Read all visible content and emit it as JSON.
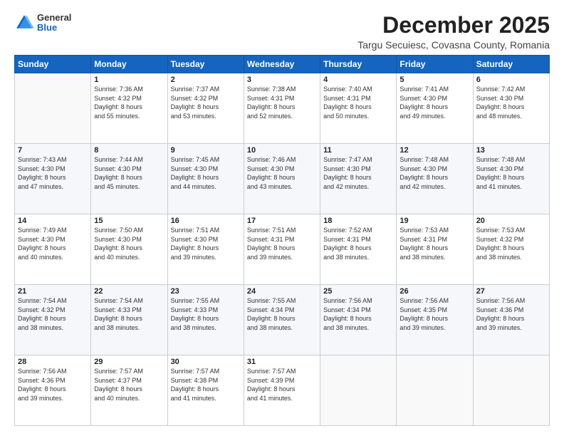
{
  "logo": {
    "general": "General",
    "blue": "Blue"
  },
  "title": "December 2025",
  "subtitle": "Targu Secuiesc, Covasna County, Romania",
  "header_days": [
    "Sunday",
    "Monday",
    "Tuesday",
    "Wednesday",
    "Thursday",
    "Friday",
    "Saturday"
  ],
  "weeks": [
    [
      {
        "day": "",
        "info": ""
      },
      {
        "day": "1",
        "info": "Sunrise: 7:36 AM\nSunset: 4:32 PM\nDaylight: 8 hours\nand 55 minutes."
      },
      {
        "day": "2",
        "info": "Sunrise: 7:37 AM\nSunset: 4:32 PM\nDaylight: 8 hours\nand 53 minutes."
      },
      {
        "day": "3",
        "info": "Sunrise: 7:38 AM\nSunset: 4:31 PM\nDaylight: 8 hours\nand 52 minutes."
      },
      {
        "day": "4",
        "info": "Sunrise: 7:40 AM\nSunset: 4:31 PM\nDaylight: 8 hours\nand 50 minutes."
      },
      {
        "day": "5",
        "info": "Sunrise: 7:41 AM\nSunset: 4:30 PM\nDaylight: 8 hours\nand 49 minutes."
      },
      {
        "day": "6",
        "info": "Sunrise: 7:42 AM\nSunset: 4:30 PM\nDaylight: 8 hours\nand 48 minutes."
      }
    ],
    [
      {
        "day": "7",
        "info": "Sunrise: 7:43 AM\nSunset: 4:30 PM\nDaylight: 8 hours\nand 47 minutes."
      },
      {
        "day": "8",
        "info": "Sunrise: 7:44 AM\nSunset: 4:30 PM\nDaylight: 8 hours\nand 45 minutes."
      },
      {
        "day": "9",
        "info": "Sunrise: 7:45 AM\nSunset: 4:30 PM\nDaylight: 8 hours\nand 44 minutes."
      },
      {
        "day": "10",
        "info": "Sunrise: 7:46 AM\nSunset: 4:30 PM\nDaylight: 8 hours\nand 43 minutes."
      },
      {
        "day": "11",
        "info": "Sunrise: 7:47 AM\nSunset: 4:30 PM\nDaylight: 8 hours\nand 42 minutes."
      },
      {
        "day": "12",
        "info": "Sunrise: 7:48 AM\nSunset: 4:30 PM\nDaylight: 8 hours\nand 42 minutes."
      },
      {
        "day": "13",
        "info": "Sunrise: 7:48 AM\nSunset: 4:30 PM\nDaylight: 8 hours\nand 41 minutes."
      }
    ],
    [
      {
        "day": "14",
        "info": "Sunrise: 7:49 AM\nSunset: 4:30 PM\nDaylight: 8 hours\nand 40 minutes."
      },
      {
        "day": "15",
        "info": "Sunrise: 7:50 AM\nSunset: 4:30 PM\nDaylight: 8 hours\nand 40 minutes."
      },
      {
        "day": "16",
        "info": "Sunrise: 7:51 AM\nSunset: 4:30 PM\nDaylight: 8 hours\nand 39 minutes."
      },
      {
        "day": "17",
        "info": "Sunrise: 7:51 AM\nSunset: 4:31 PM\nDaylight: 8 hours\nand 39 minutes."
      },
      {
        "day": "18",
        "info": "Sunrise: 7:52 AM\nSunset: 4:31 PM\nDaylight: 8 hours\nand 38 minutes."
      },
      {
        "day": "19",
        "info": "Sunrise: 7:53 AM\nSunset: 4:31 PM\nDaylight: 8 hours\nand 38 minutes."
      },
      {
        "day": "20",
        "info": "Sunrise: 7:53 AM\nSunset: 4:32 PM\nDaylight: 8 hours\nand 38 minutes."
      }
    ],
    [
      {
        "day": "21",
        "info": "Sunrise: 7:54 AM\nSunset: 4:32 PM\nDaylight: 8 hours\nand 38 minutes."
      },
      {
        "day": "22",
        "info": "Sunrise: 7:54 AM\nSunset: 4:33 PM\nDaylight: 8 hours\nand 38 minutes."
      },
      {
        "day": "23",
        "info": "Sunrise: 7:55 AM\nSunset: 4:33 PM\nDaylight: 8 hours\nand 38 minutes."
      },
      {
        "day": "24",
        "info": "Sunrise: 7:55 AM\nSunset: 4:34 PM\nDaylight: 8 hours\nand 38 minutes."
      },
      {
        "day": "25",
        "info": "Sunrise: 7:56 AM\nSunset: 4:34 PM\nDaylight: 8 hours\nand 38 minutes."
      },
      {
        "day": "26",
        "info": "Sunrise: 7:56 AM\nSunset: 4:35 PM\nDaylight: 8 hours\nand 39 minutes."
      },
      {
        "day": "27",
        "info": "Sunrise: 7:56 AM\nSunset: 4:36 PM\nDaylight: 8 hours\nand 39 minutes."
      }
    ],
    [
      {
        "day": "28",
        "info": "Sunrise: 7:56 AM\nSunset: 4:36 PM\nDaylight: 8 hours\nand 39 minutes."
      },
      {
        "day": "29",
        "info": "Sunrise: 7:57 AM\nSunset: 4:37 PM\nDaylight: 8 hours\nand 40 minutes."
      },
      {
        "day": "30",
        "info": "Sunrise: 7:57 AM\nSunset: 4:38 PM\nDaylight: 8 hours\nand 41 minutes."
      },
      {
        "day": "31",
        "info": "Sunrise: 7:57 AM\nSunset: 4:39 PM\nDaylight: 8 hours\nand 41 minutes."
      },
      {
        "day": "",
        "info": ""
      },
      {
        "day": "",
        "info": ""
      },
      {
        "day": "",
        "info": ""
      }
    ]
  ]
}
